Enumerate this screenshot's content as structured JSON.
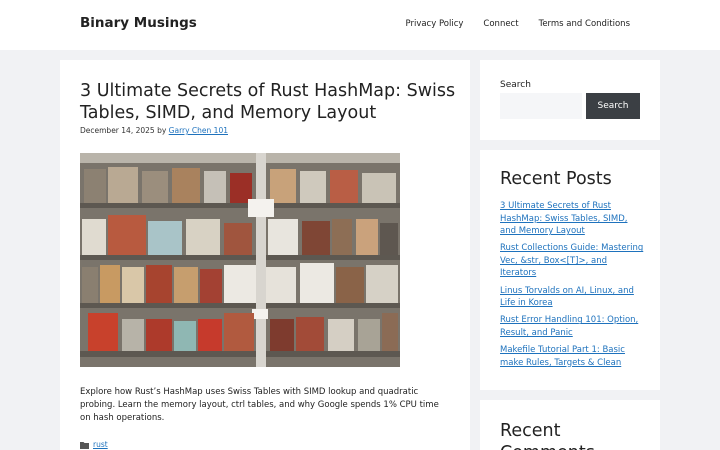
{
  "site": {
    "title": "Binary Musings"
  },
  "nav": {
    "items": [
      "Privacy Policy",
      "Connect",
      "Terms and Conditions"
    ]
  },
  "article": {
    "title": "3 Ultimate Secrets of Rust HashMap: Swiss Tables, SIMD, and Memory Layout",
    "date": "December 14, 2025",
    "by": "by",
    "author": "Garry Chen 101",
    "excerpt": "Explore how Rust’s HashMap uses Swiss Tables with SIMD lookup and quadratic probing. Learn the memory layout, ctrl tables, and why Google spends 1% CPU time on hash operations.",
    "category_icon": "folder-icon",
    "category": "rust"
  },
  "sidebar": {
    "search": {
      "label": "Search",
      "button": "Search",
      "value": ""
    },
    "recent_posts": {
      "title": "Recent Posts",
      "items": [
        "3 Ultimate Secrets of Rust HashMap: Swiss Tables, SIMD, and Memory Layout",
        "Rust Collections Guide: Mastering Vec, &str, Box<[T]>, and Iterators",
        "Linus Torvalds on AI, Linux, and Life in Korea",
        "Rust Error Handling 101: Option, Result, and Panic",
        "Makefile Tutorial Part 1: Basic make Rules, Targets & Clean"
      ]
    },
    "recent_comments": {
      "title": "Recent Comments"
    }
  },
  "colors": {
    "background": "#f1f2f4",
    "link": "#1e72bd",
    "button": "#3b3f44"
  }
}
